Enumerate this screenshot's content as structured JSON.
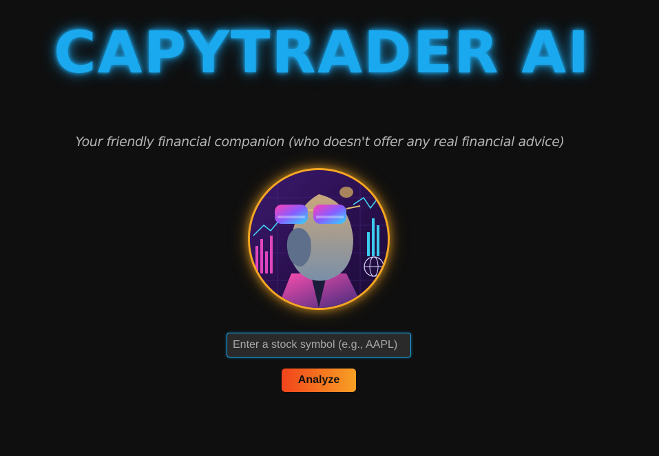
{
  "header": {
    "title": "CAPYTRADER AI",
    "tagline": "Your friendly financial companion (who doesn't offer any real financial advice)"
  },
  "avatar": {
    "subject": "capybara-trader-avatar",
    "ring_color": "#f5a623"
  },
  "form": {
    "symbol_placeholder": "Enter a stock symbol (e.g., AAPL)",
    "symbol_value": "",
    "analyze_label": "Analyze"
  },
  "theme": {
    "background": "#0f0f0f",
    "title_color": "#1aa9ee",
    "input_border": "#1aa9ee",
    "button_gradient_start": "#f2441b",
    "button_gradient_end": "#f7a024"
  }
}
